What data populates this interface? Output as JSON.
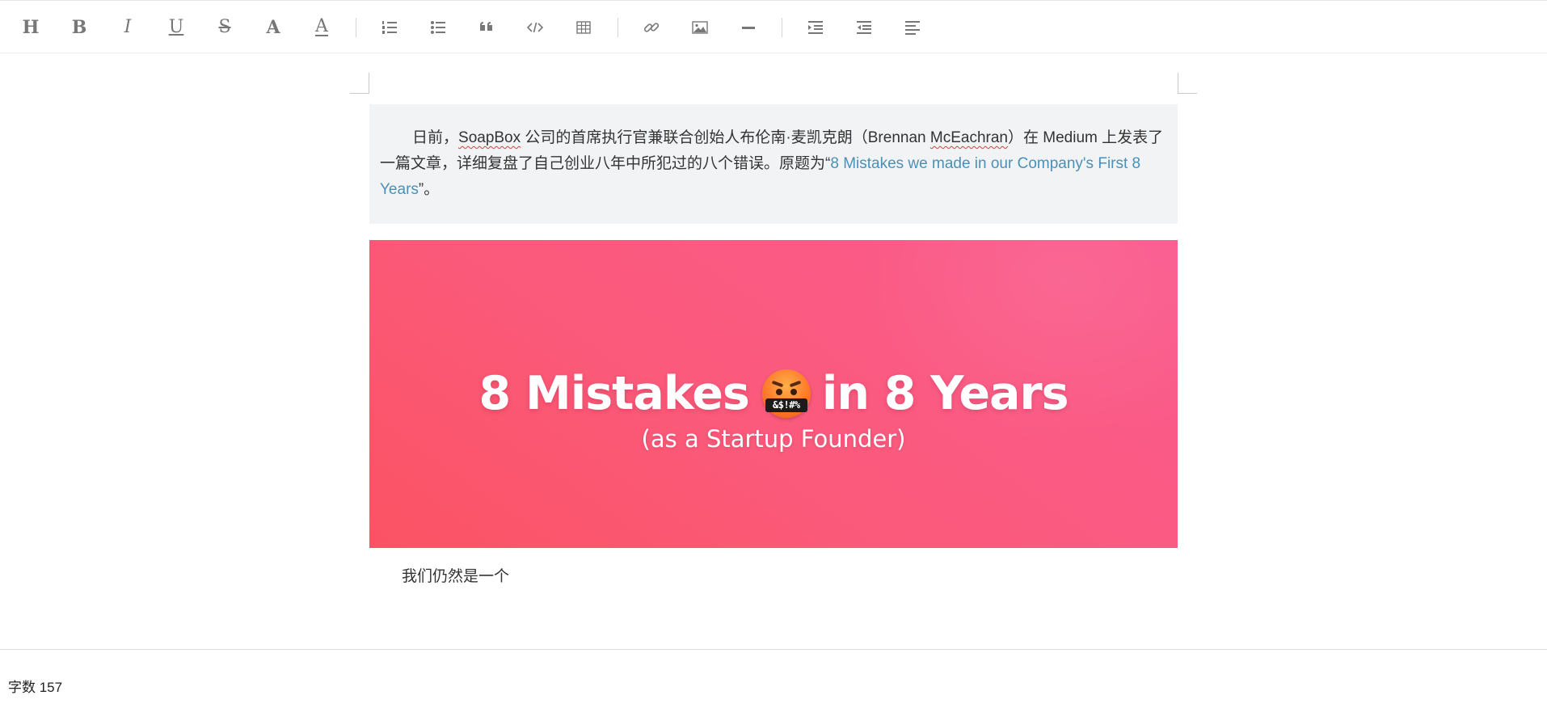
{
  "toolbar": {
    "heading_label": "H",
    "bold_label": "B",
    "italic_label": "I",
    "underline_label": "U",
    "strike_label": "S",
    "font_label": "A",
    "color_label": "A"
  },
  "editor": {
    "quote": {
      "text_before_1": "日前，",
      "name_soapbox": "SoapBox",
      "text_before_2": " 公司的首席执行官兼联合创始人布伦南·麦凯克朗（Brennan ",
      "name_mceachran": "McEachran",
      "text_after": "）在 Medium 上发表了一篇文章，详细复盘了自己创业八年中所犯过的八个错误。原题为“",
      "link_text": "8 Mistakes we made in our Company's First 8 Years",
      "text_end": "”。"
    },
    "banner": {
      "title_left": "8 Mistakes",
      "emoji_text": "&$!#%",
      "title_right": "in 8 Years",
      "subtitle": "(as a Startup Founder)"
    },
    "paragraph": "我们仍然是一个"
  },
  "status": {
    "word_count": "字数 157"
  }
}
